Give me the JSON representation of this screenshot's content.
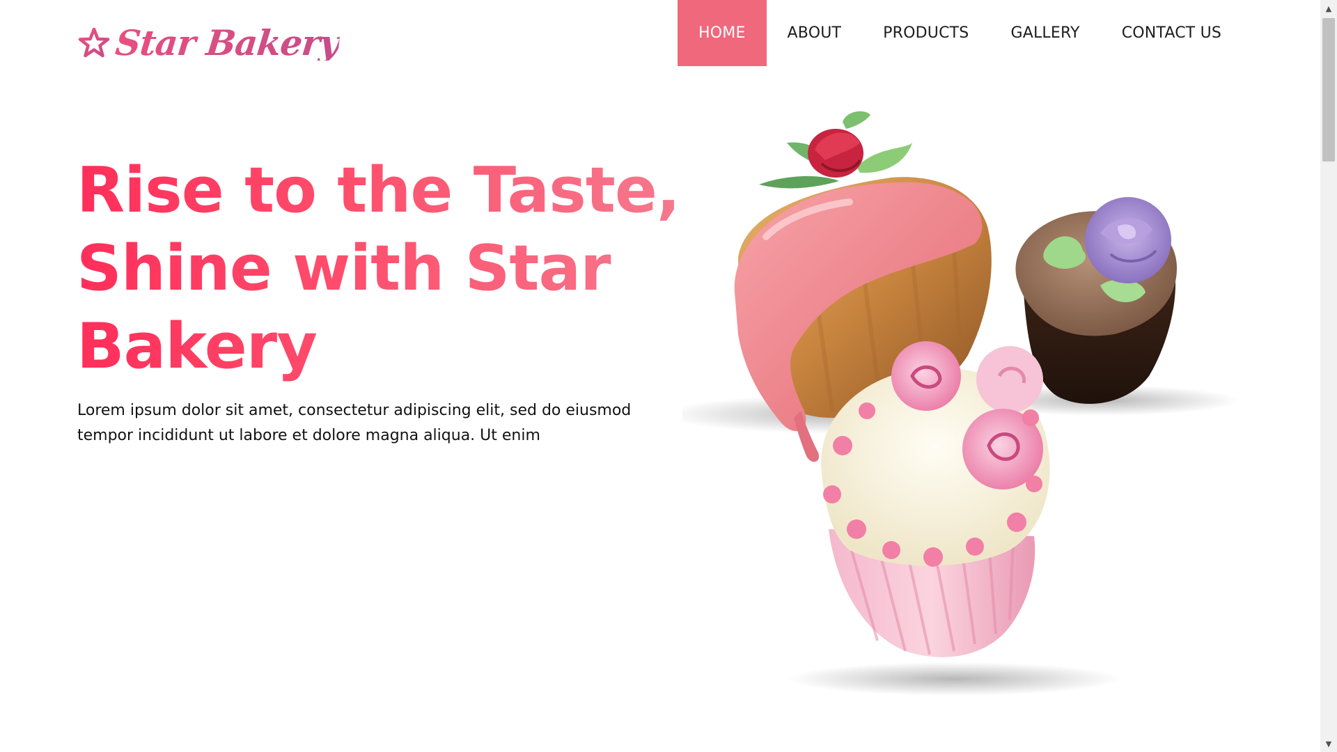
{
  "brand": {
    "name": "Star Bakery",
    "star_icon": "star-icon",
    "color": "#d94f86"
  },
  "nav": {
    "items": [
      {
        "label": "HOME",
        "active": true
      },
      {
        "label": "ABOUT",
        "active": false
      },
      {
        "label": "PRODUCTS",
        "active": false
      },
      {
        "label": "GALLERY",
        "active": false
      },
      {
        "label": "CONTACT US",
        "active": false
      }
    ],
    "active_color": "#f0687c"
  },
  "hero": {
    "title_line1": "Rise to the Taste,",
    "title_line2": "Shine with Star",
    "title_line3": "Bakery",
    "description": "Lorem ipsum dolor sit amet, consectetur adipiscing elit, sed do eiusmod tempor incididunt ut labore et dolore magna aliqua. Ut enim",
    "title_color": "#fe3d64"
  },
  "artwork": {
    "items": [
      "glazed-muffin-with-rosebud",
      "chocolate-cupcake-with-purple-rose",
      "pink-rose-cupcake"
    ]
  },
  "scrollbar": {
    "up_icon": "▲",
    "down_icon": "▼"
  }
}
